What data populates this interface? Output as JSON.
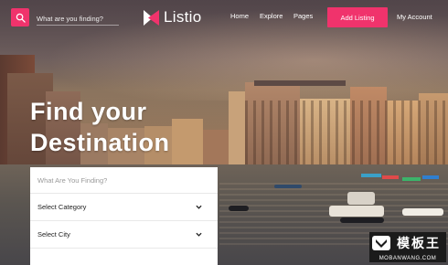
{
  "header": {
    "search_placeholder": "What are you finding?",
    "logo_text": "Listio",
    "nav": [
      "Home",
      "Explore",
      "Pages"
    ],
    "add_listing_label": "Add Listing",
    "account_label": "My Account"
  },
  "hero": {
    "headline_line1": "Find your",
    "headline_line2": "Destination"
  },
  "form": {
    "keyword_placeholder": "What Are You Finding?",
    "category_value": "Select Category",
    "city_value": "Select City"
  },
  "watermark": {
    "cn_text": "模板王",
    "url_text": "MOBANWANG.COM"
  },
  "colors": {
    "accent": "#f0336c"
  }
}
